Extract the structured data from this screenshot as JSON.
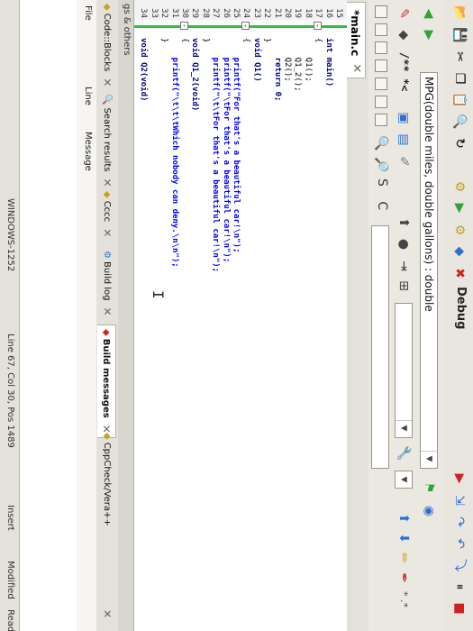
{
  "toolbar": {
    "debug_label": "Debug",
    "function_combo": "MPG(double miles, double gallons) : double",
    "comment_combo": "/** *<",
    "search_letters": "S C",
    "right_symbols": "* .*"
  },
  "editor": {
    "tab_label": "*main.c",
    "lines": [
      {
        "num": "15",
        "text": ""
      },
      {
        "num": "16",
        "text": "int main()"
      },
      {
        "num": "17",
        "text": "{"
      },
      {
        "num": "18",
        "text": "    Q1();"
      },
      {
        "num": "19",
        "text": "    Q1_2();"
      },
      {
        "num": "20",
        "text": "    Q2();"
      },
      {
        "num": "21",
        "text": "    return 0;"
      },
      {
        "num": "22",
        "text": "}"
      },
      {
        "num": "23",
        "text": "void Q1()"
      },
      {
        "num": "24",
        "text": "{"
      },
      {
        "num": "25",
        "text": "    printf(\"For that's a beautiful car!\\n\");"
      },
      {
        "num": "26",
        "text": "    printf(\"\\tFor that's a beautiful car!\\n\");"
      },
      {
        "num": "27",
        "text": "    printf(\"\\t\\tFor that's a beautiful car!\\n\");"
      },
      {
        "num": "28",
        "text": "}"
      },
      {
        "num": "29",
        "text": "void Q1_2(void)"
      },
      {
        "num": "30",
        "text": "{"
      },
      {
        "num": "31",
        "text": "    printf(\"\\t\\t\\tWhich nobody can deny.\\n\\n\");"
      },
      {
        "num": "32",
        "text": "}"
      },
      {
        "num": "33",
        "text": ""
      },
      {
        "num": "34",
        "text": "void Q2(void)"
      }
    ]
  },
  "logs": {
    "panel_title": "gs & others",
    "tabs": [
      {
        "label": "Code::Blocks"
      },
      {
        "label": "Search results"
      },
      {
        "label": "Cccc"
      },
      {
        "label": "Build log"
      },
      {
        "label": "Build messages"
      },
      {
        "label": "CppCheck/Vera++"
      }
    ],
    "columns": {
      "file": "File",
      "line": "Line",
      "message": "Message"
    }
  },
  "status": {
    "encoding": "WINDOWS-1252",
    "position": "Line 67, Col 30, Pos 1489",
    "insert": "Insert",
    "modified": "Modified",
    "readwrite": "Read"
  },
  "colors": {
    "keyword": "#000080",
    "string": "#0000ff",
    "default": "#000000",
    "accent_green": "#2fbf3f",
    "red_cross": "#d02020"
  },
  "icons": [
    "gear-icon",
    "play-icon",
    "build-run-icon",
    "abort-icon",
    "debug-icon",
    "zoom-icon",
    "toggle-comment-icon",
    "red-arrow-icon"
  ]
}
